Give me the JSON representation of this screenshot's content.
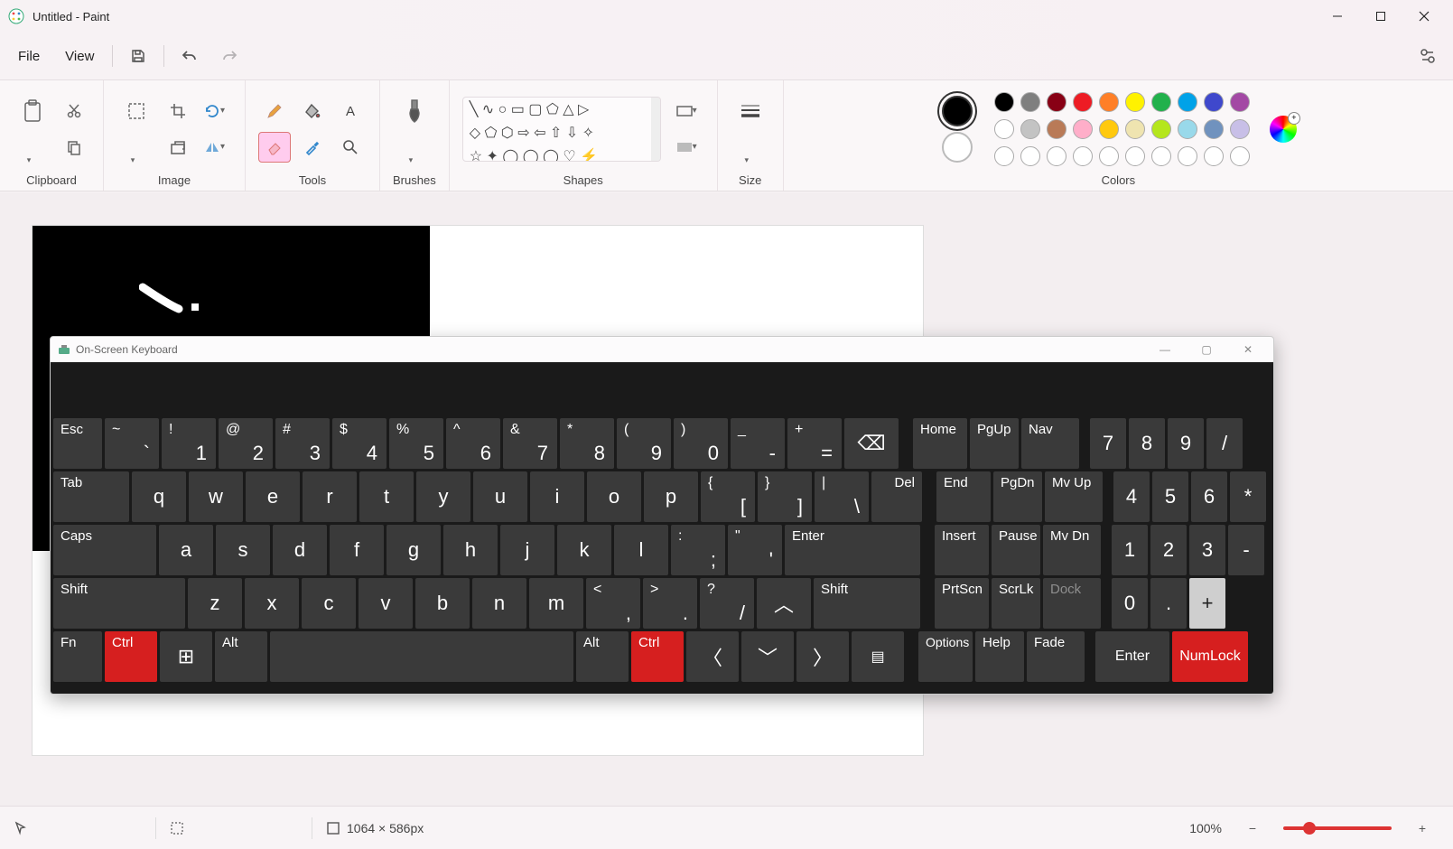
{
  "window": {
    "title": "Untitled - Paint"
  },
  "menu": {
    "file": "File",
    "view": "View"
  },
  "ribbon": {
    "clipboard": "Clipboard",
    "image": "Image",
    "tools": "Tools",
    "brushes": "Brushes",
    "shapes": "Shapes",
    "size": "Size",
    "colors": "Colors"
  },
  "colors": {
    "color1": "#000000",
    "color2": "#ffffff",
    "row1": [
      "#000000",
      "#7f7f7f",
      "#880015",
      "#ed1c24",
      "#ff7f27",
      "#fff200",
      "#22b14c",
      "#00a2e8",
      "#3f48cc",
      "#a349a4"
    ],
    "row2": [
      "#ffffff",
      "#c3c3c3",
      "#b97a57",
      "#ffaec9",
      "#ffc90e",
      "#efe4b0",
      "#b5e61d",
      "#99d9ea",
      "#7092be",
      "#c8bfe7"
    ]
  },
  "osk": {
    "title": "On-Screen Keyboard",
    "row1": {
      "esc": "Esc",
      "backspace_icon": "⌫",
      "k1": {
        "sup": "~",
        "sub": "`"
      },
      "k2": {
        "sup": "!",
        "sub": "1"
      },
      "k3": {
        "sup": "@",
        "sub": "2"
      },
      "k4": {
        "sup": "#",
        "sub": "3"
      },
      "k5": {
        "sup": "$",
        "sub": "4"
      },
      "k6": {
        "sup": "%",
        "sub": "5"
      },
      "k7": {
        "sup": "^",
        "sub": "6"
      },
      "k8": {
        "sup": "&",
        "sub": "7"
      },
      "k9": {
        "sup": "*",
        "sub": "8"
      },
      "k10": {
        "sup": "(",
        "sub": "9"
      },
      "k11": {
        "sup": ")",
        "sub": "0"
      },
      "k12": {
        "sup": "_",
        "sub": "-"
      },
      "k13": {
        "sup": "+",
        "sub": "="
      },
      "home": "Home",
      "pgup": "PgUp",
      "nav": "Nav",
      "n7": "7",
      "n8": "8",
      "n9": "9",
      "ndiv": "/"
    },
    "row2": {
      "tab": "Tab",
      "q": "q",
      "w": "w",
      "e": "e",
      "r": "r",
      "t": "t",
      "y": "y",
      "u": "u",
      "i": "i",
      "o": "o",
      "p": "p",
      "br1": {
        "sup": "{",
        "sub": "["
      },
      "br2": {
        "sup": "}",
        "sub": "]"
      },
      "bs": {
        "sup": "|",
        "sub": "\\"
      },
      "del": "Del",
      "end": "End",
      "pgdn": "PgDn",
      "mvup": "Mv Up",
      "n4": "4",
      "n5": "5",
      "n6": "6",
      "nmul": "*"
    },
    "row3": {
      "caps": "Caps",
      "a": "a",
      "s": "s",
      "d": "d",
      "f": "f",
      "g": "g",
      "h": "h",
      "j": "j",
      "k": "k",
      "l": "l",
      "sc": {
        "sup": ":",
        "sub": ";"
      },
      "qt": {
        "sup": "\"",
        "sub": "'"
      },
      "enter": "Enter",
      "insert": "Insert",
      "pause": "Pause",
      "mvdn": "Mv Dn",
      "n1": "1",
      "n2": "2",
      "n3": "3",
      "nsub": "-"
    },
    "row4": {
      "shiftL": "Shift",
      "z": "z",
      "x": "x",
      "c": "c",
      "v": "v",
      "b": "b",
      "n": "n",
      "m": "m",
      "cm": {
        "sup": "<",
        "sub": ","
      },
      "pd": {
        "sup": ">",
        "sub": "."
      },
      "sl": {
        "sup": "?",
        "sub": "/"
      },
      "up": "︿",
      "shiftR": "Shift",
      "prtscn": "PrtScn",
      "scrlk": "ScrLk",
      "dock": "Dock",
      "n0": "0",
      "ndot": ".",
      "nadd": "+"
    },
    "row5": {
      "fn": "Fn",
      "ctrlL": "Ctrl",
      "win": "⊞",
      "altL": "Alt",
      "space": "",
      "altR": "Alt",
      "ctrlR": "Ctrl",
      "left": "〈",
      "down": "﹀",
      "right": "〉",
      "menu": "▤",
      "options": "Options",
      "help": "Help",
      "fade": "Fade",
      "nenter": "Enter",
      "numlock": "NumLock"
    }
  },
  "status": {
    "dimensions": "1064 × 586px",
    "zoom": "100%"
  }
}
